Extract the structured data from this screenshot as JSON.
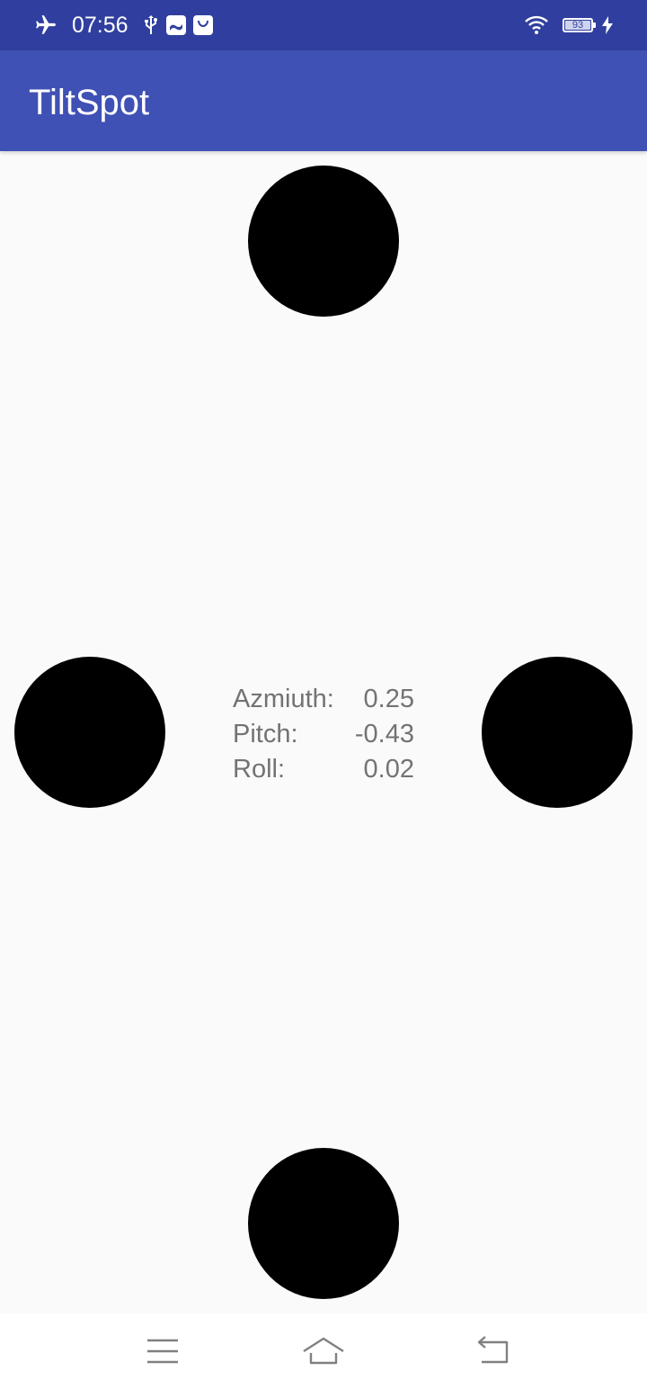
{
  "status_bar": {
    "time": "07:56",
    "battery_level": "93",
    "left_icons": [
      "airplane-mode-icon",
      "usb-icon",
      "photos-notification-icon",
      "bag-notification-icon"
    ],
    "right_icons": [
      "wifi-icon",
      "battery-icon",
      "charging-icon"
    ]
  },
  "app_bar": {
    "title": "TiltSpot",
    "color": "#3f51b5",
    "status_color": "#303f9f"
  },
  "sensor_readout": {
    "azimuth_label": "Azmiuth:",
    "azimuth_value": "0.25",
    "pitch_label": "Pitch:",
    "pitch_value": "-0.43",
    "roll_label": "Roll:",
    "roll_value": "0.02"
  },
  "spots": {
    "color": "#000000",
    "items": [
      "spot-top",
      "spot-left",
      "spot-right",
      "spot-bottom"
    ]
  },
  "nav_bar": {
    "buttons": [
      "menu-icon",
      "home-icon",
      "back-icon"
    ]
  }
}
